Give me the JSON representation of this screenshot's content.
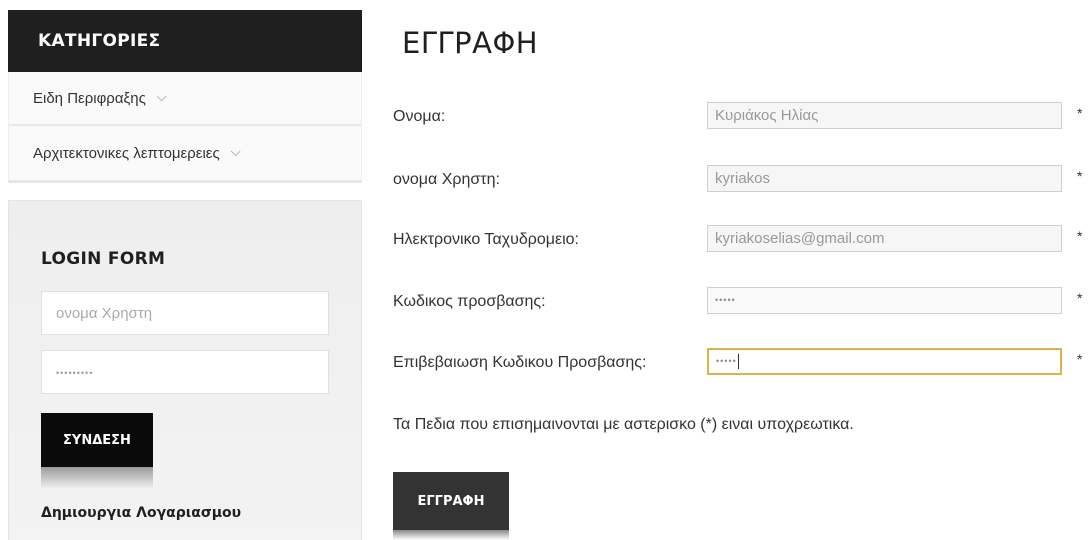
{
  "sidebar": {
    "categories_title": "ΚΑΤΗΓΟΡΙΕΣ",
    "categories": [
      {
        "label": "Ειδη Περιφραξης"
      },
      {
        "label": "Αρχιτεκτονικες λεπτομερειες"
      }
    ],
    "login": {
      "title": "LOGIN FORM",
      "username_placeholder": "ονομα Χρηστη",
      "password_masked": "•••••••••",
      "submit_label": "ΣΥΝΔΕΣΗ",
      "create_account_label": "Δημιουργια Λογαριασμου"
    }
  },
  "main": {
    "title": "ΕΓΓΡΑΦΗ",
    "fields": [
      {
        "label": "Ονομα:",
        "value": "Κυριάκος Ηλίας",
        "required_mark": "*"
      },
      {
        "label": "ονομα Χρηστη:",
        "value": "kyriakos",
        "required_mark": "*"
      },
      {
        "label": "Ηλεκτρονικο Ταχυδρομειο:",
        "value": "kyriakoselias@gmail.com",
        "required_mark": "*"
      },
      {
        "label": "Κωδικος προσβασης:",
        "value": "•••••",
        "required_mark": "*"
      },
      {
        "label": "Επιβεβαιωση Κωδικου Προσβασης:",
        "value": "•••••",
        "required_mark": "*"
      }
    ],
    "required_note": "Τα Πεδια που επισημαινονται με αστερισκο (*) ειναι υποχρεωτικα.",
    "submit_label": "ΕΓΓΡΑΦΗ"
  },
  "colors": {
    "dark_header": "#1f1f1f",
    "focus_border": "#e0b24a"
  }
}
